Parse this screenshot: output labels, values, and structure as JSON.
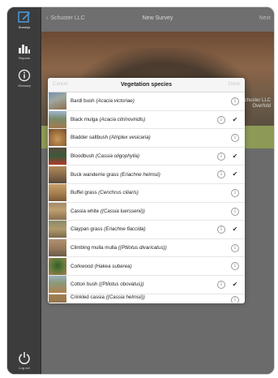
{
  "sidebar": {
    "items": [
      {
        "label": "Surveys",
        "icon": "edit-icon",
        "active": true
      },
      {
        "label": "Reports",
        "icon": "bar-chart-icon",
        "active": false
      },
      {
        "label": "Glossary",
        "icon": "info-icon",
        "active": false
      }
    ],
    "logout_label": "Log out"
  },
  "nav": {
    "back_label": "Schuster LLC",
    "title": "New Survey",
    "next_label": "Next"
  },
  "hero": {
    "line1": "Schuster LLC",
    "line2": "Overfold"
  },
  "modal": {
    "cancel_label": "Cancel",
    "title": "Vegetation species",
    "done_label": "Done",
    "items": [
      {
        "common": "Bardi bush",
        "scientific": "(Acacia victoriae)",
        "checked": false
      },
      {
        "common": "Black mulga",
        "scientific": "(Acacia citrinoviridis)",
        "checked": true
      },
      {
        "common": "Bladder saltbush",
        "scientific": "(Atriplex vesicaria)",
        "checked": false
      },
      {
        "common": "Bloodbush",
        "scientific": "(Cassia oligophylla)",
        "checked": true
      },
      {
        "common": "Buck wanderrie grass",
        "scientific": "(Eriachne helmsii)",
        "checked": true
      },
      {
        "common": "Buffel grass",
        "scientific": "(Cenchrus ciliaris)",
        "checked": false
      },
      {
        "common": "Cassia white",
        "scientific": "((Cassia luerssenii))",
        "checked": false
      },
      {
        "common": "Claypan grass",
        "scientific": "(Eriachne flaccida)",
        "checked": true
      },
      {
        "common": "Climbing mulla mulla",
        "scientific": "((Ptilotus divaricatus))",
        "checked": false
      },
      {
        "common": "Corkwood",
        "scientific": "(Hakea suberea)",
        "checked": false
      },
      {
        "common": "Cotton bush",
        "scientific": "((Ptilotus obovatus))",
        "checked": true
      },
      {
        "common": "Crinkled cassia",
        "scientific": "((Cassia helmsii))",
        "checked": false
      }
    ]
  },
  "colors": {
    "sidebar_bg": "#3c3c3c",
    "green_band": "#8c9a56",
    "modal_bg": "#ffffff"
  }
}
